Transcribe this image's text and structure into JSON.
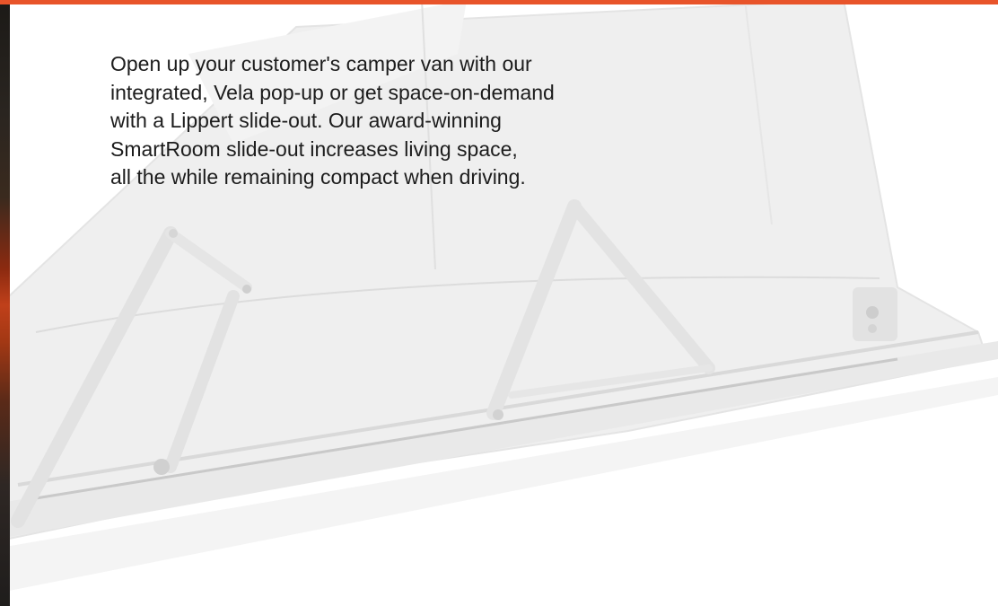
{
  "theme": {
    "accent_color": "#e8542a",
    "text_color": "#1c1c1c",
    "background_color": "#ffffff"
  },
  "hero": {
    "image_subject": "pop-up-tent-frame-illustration"
  },
  "intro": {
    "text": "Open up your customer's camper van with our\nintegrated, Vela pop-up or get space-on-demand\nwith a Lippert slide-out. Our award-winning\nSmartRoom slide-out increases living space,\nall the while remaining compact when driving."
  }
}
